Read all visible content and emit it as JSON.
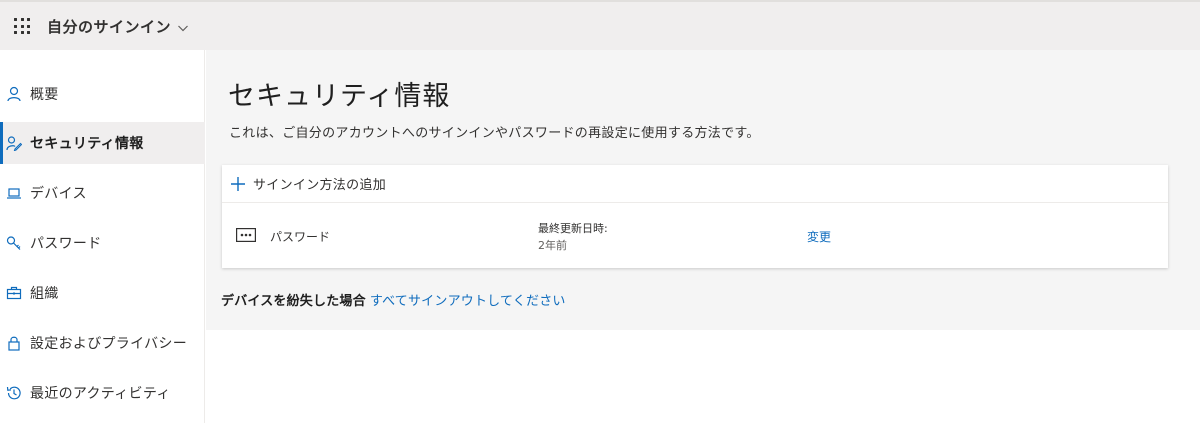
{
  "header": {
    "app_title": "自分のサインイン",
    "menu_icon": "waffle-icon",
    "dropdown_icon": "chevron-down-icon"
  },
  "sidebar": {
    "items": [
      {
        "label": "概要",
        "icon": "person-icon",
        "active": false
      },
      {
        "label": "セキュリティ情報",
        "icon": "security-info-icon",
        "active": true
      },
      {
        "label": "デバイス",
        "icon": "laptop-icon",
        "active": false
      },
      {
        "label": "パスワード",
        "icon": "key-icon",
        "active": false
      },
      {
        "label": "組織",
        "icon": "briefcase-icon",
        "active": false
      },
      {
        "label": "設定およびプライバシー",
        "icon": "lock-icon",
        "active": false
      },
      {
        "label": "最近のアクティビティ",
        "icon": "history-icon",
        "active": false
      }
    ]
  },
  "main": {
    "title": "セキュリティ情報",
    "description": "これは、ご自分のアカウントへのサインインやパスワードの再設定に使用する方法です。",
    "add_method_label": "サインイン方法の追加",
    "methods": [
      {
        "name": "パスワード",
        "icon": "password-dots-icon",
        "updated_label": "最終更新日時:",
        "updated_value": "2年前",
        "action_label": "変更"
      }
    ],
    "lost_device_text": "デバイスを紛失した場合",
    "lost_device_link": "すべてサインアウトしてください"
  },
  "colors": {
    "accent": "#0f6cbd",
    "topbar_bg": "#f0eeee",
    "main_bg": "#f5f5f5"
  }
}
